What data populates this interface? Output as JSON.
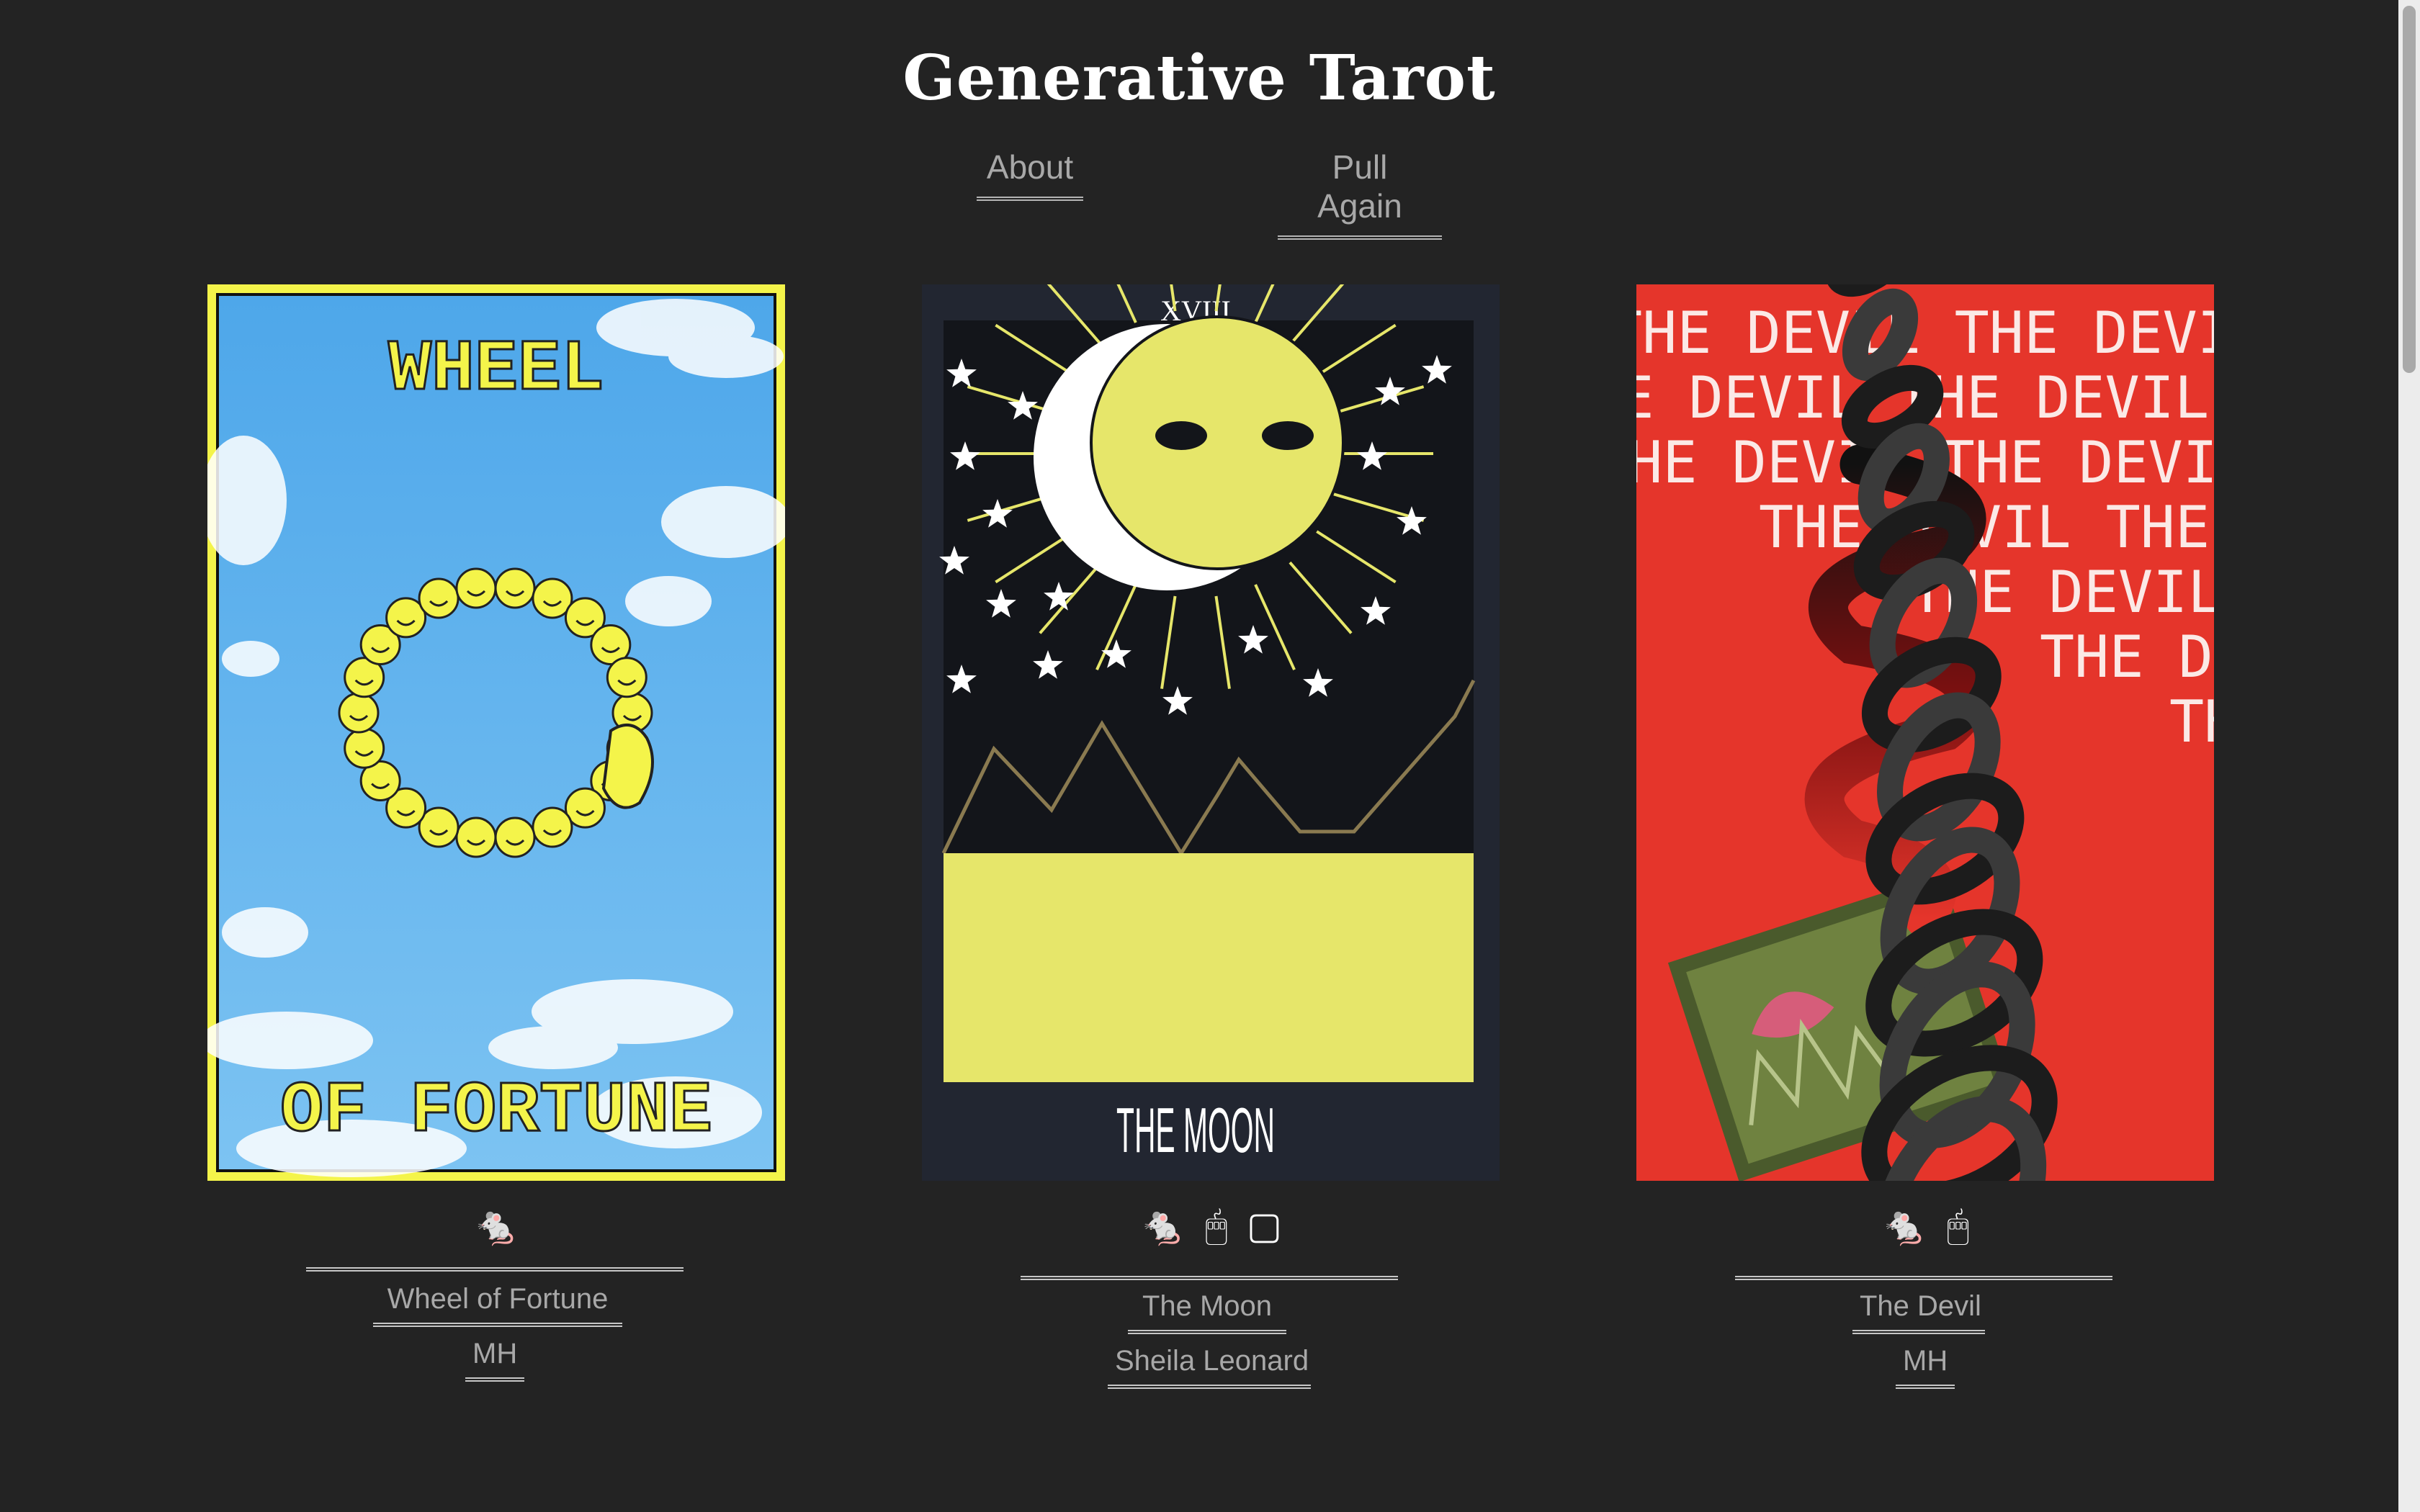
{
  "header": {
    "title": "Generative Tarot",
    "nav": {
      "about": "About",
      "pull_again": "Pull Again"
    }
  },
  "cards": [
    {
      "name": "Wheel of Fortune",
      "author": "MH",
      "art_text_top": "WHEEL",
      "art_text_bottom": "OF FORTUNE",
      "icons": [
        "🐁"
      ]
    },
    {
      "name": "The Moon",
      "author": "Sheila Leonard",
      "art_numeral": "XVIII",
      "art_text_bottom": "THE MOON",
      "icons": [
        "🐁",
        "🖱",
        "▢"
      ]
    },
    {
      "name": "The Devil",
      "author": "MH",
      "art_text_repeat": "THE DEVIL",
      "icons": [
        "🐁",
        "🖱"
      ]
    }
  ],
  "colors": {
    "background": "#232323",
    "wheel_border": "#f4f44a",
    "sky": "#5faee9",
    "moon_yellow": "#e6e66a",
    "moon_bg": "#13151a",
    "devil_red": "#e5352b"
  },
  "icon_names": [
    "mouse-icon",
    "cursor-click-icon",
    "tablet-icon"
  ]
}
